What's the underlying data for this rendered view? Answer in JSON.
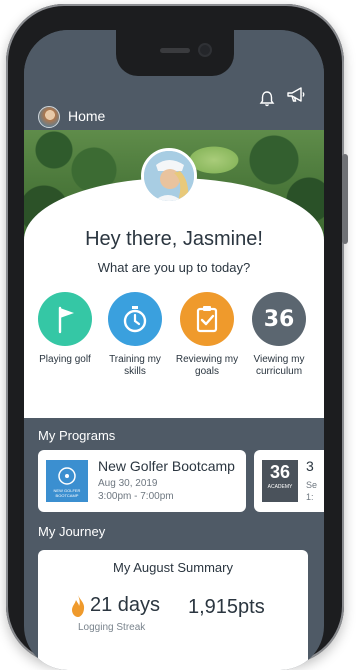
{
  "header": {
    "title": "Home"
  },
  "hero": {
    "greeting": "Hey there, Jasmine!",
    "subtitle": "What are you up to today?"
  },
  "actions": [
    {
      "label": "Playing golf",
      "icon": "golf-flag-icon",
      "color": "#35c7a5"
    },
    {
      "label": "Training my skills",
      "icon": "stopwatch-icon",
      "color": "#3aa0de"
    },
    {
      "label": "Reviewing my goals",
      "icon": "clipboard-check-icon",
      "color": "#ef9a2c"
    },
    {
      "label": "Viewing my curriculum",
      "icon": "academy-36-icon",
      "color": "#5b6670",
      "glyph": "36"
    }
  ],
  "programs": {
    "title": "My Programs",
    "items": [
      {
        "name": "New Golfer Bootcamp",
        "date": "Aug 30, 2019",
        "time": "3:00pm - 7:00pm",
        "badge": "NEW GOLFER BOOTCAMP"
      },
      {
        "name": "3",
        "badge_number": "36",
        "badge_label": "ACADEMY",
        "line1": "Se",
        "line2": "1:"
      }
    ]
  },
  "journey": {
    "title": "My Journey",
    "summary_title": "My August Summary",
    "streak_value": "21 days",
    "streak_label": "Logging Streak",
    "points_value": "1,915pts"
  },
  "colors": {
    "topbar": "#4f5a66",
    "text_dark": "#2b3640",
    "accent_green": "#35c7a5",
    "accent_blue": "#3aa0de",
    "accent_orange": "#ef9a2c",
    "accent_gray": "#5b6670"
  }
}
